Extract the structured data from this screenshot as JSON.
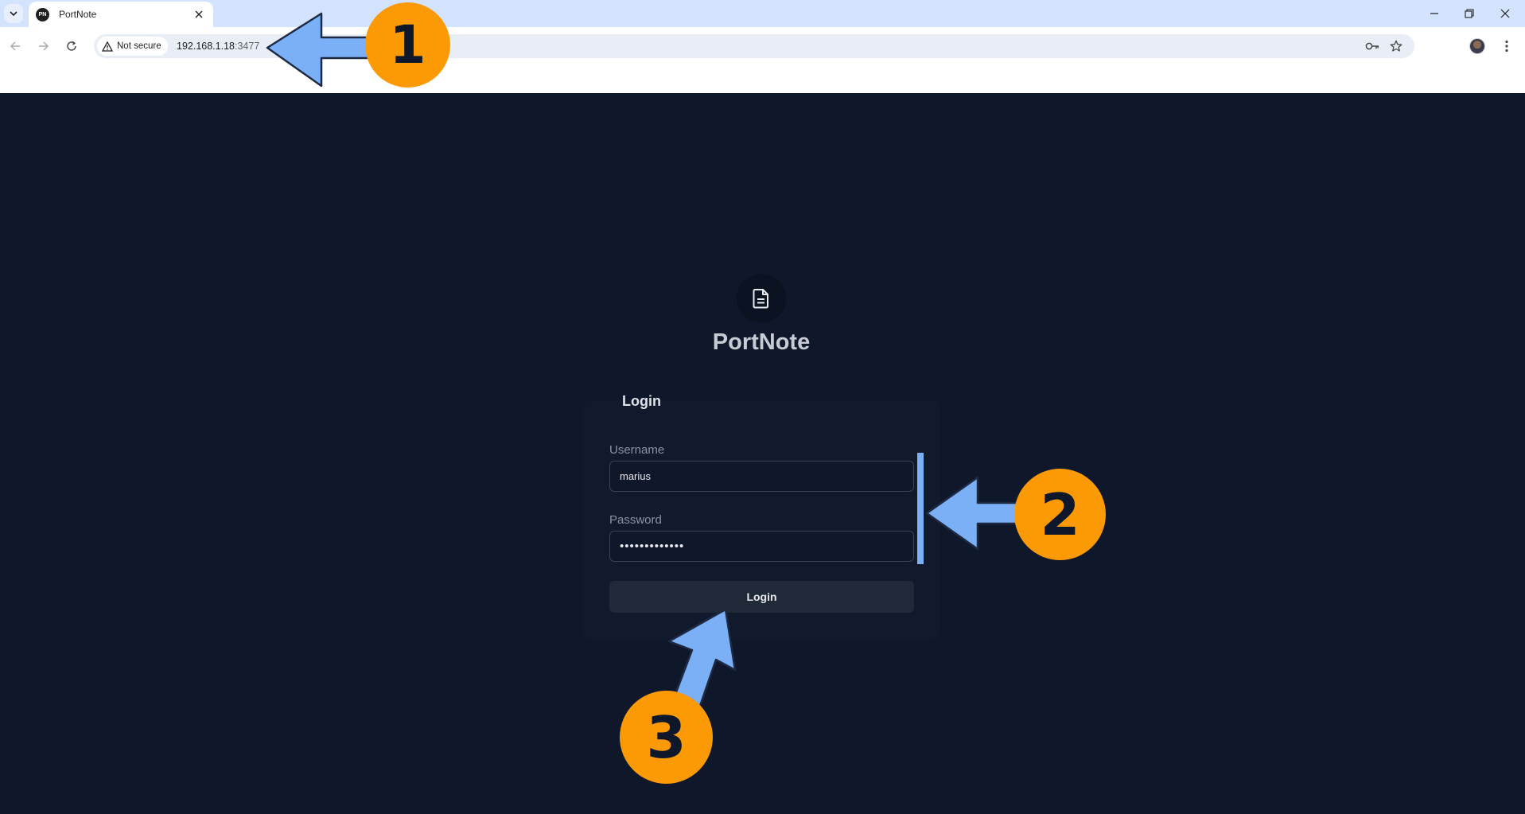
{
  "browser": {
    "tab_title": "PortNote",
    "favicon_text": "PN",
    "security_label": "Not secure",
    "url_host": "192.168.1.18",
    "url_port": ":3477"
  },
  "page": {
    "app_name": "PortNote",
    "card_title": "Login",
    "username_label": "Username",
    "username_value": "marius",
    "password_label": "Password",
    "password_value": "passwordvalue",
    "login_button": "Login"
  },
  "annotations": {
    "step1": "1",
    "step2": "2",
    "step3": "3",
    "badge_color": "#fb9a05",
    "arrow_color": "#7cb0f6"
  }
}
